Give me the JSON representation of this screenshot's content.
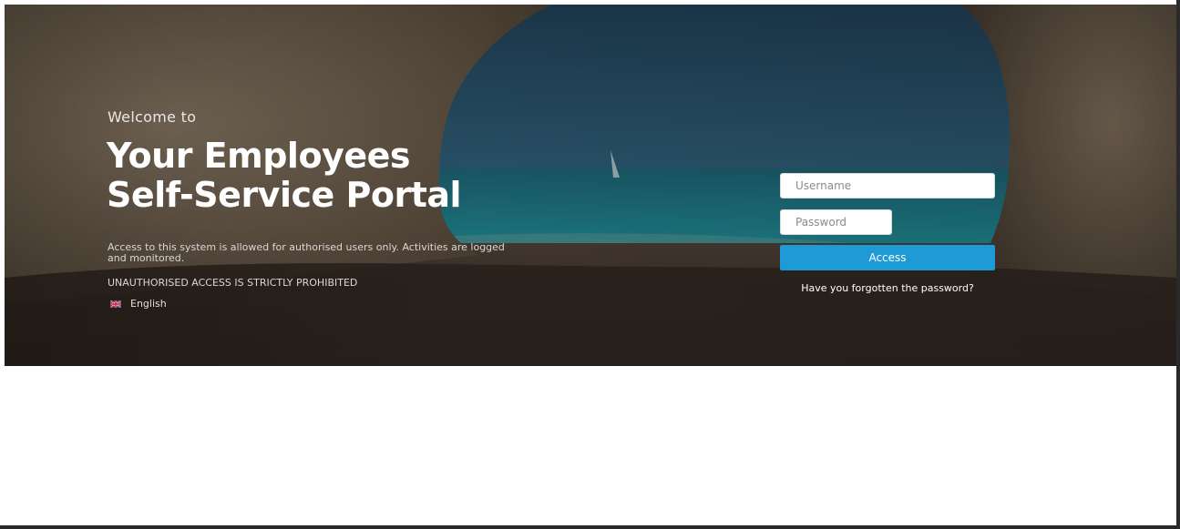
{
  "hero": {
    "welcome": "Welcome to",
    "title_line1": "Your Employees",
    "title_line2": "Self-Service Portal",
    "notice": "Access to this system is allowed for authorised users only. Activities are logged and monitored.",
    "warning": "UNAUTHORISED ACCESS IS STRICTLY PROHIBITED",
    "language": {
      "label": "English",
      "flag_icon": "uk-flag-icon"
    }
  },
  "login": {
    "username": {
      "value": "",
      "placeholder": "Username"
    },
    "password": {
      "value": "",
      "placeholder": "Password"
    },
    "access_label": "Access",
    "forgot_label": "Have you forgotten the password?"
  },
  "colors": {
    "accent": "#1e9ad6",
    "text_light": "#ffffff",
    "page_bg": "#ffffff"
  }
}
